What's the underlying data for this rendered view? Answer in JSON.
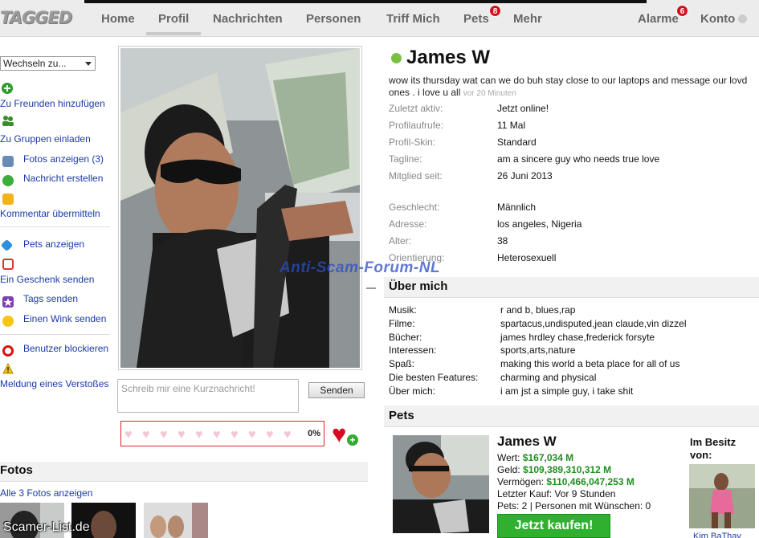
{
  "header": {
    "logo": "TAGGED",
    "nav": [
      {
        "label": "Home"
      },
      {
        "label": "Profil"
      },
      {
        "label": "Nachrichten"
      },
      {
        "label": "Personen"
      },
      {
        "label": "Triff Mich"
      },
      {
        "label": "Pets",
        "badge": "8"
      },
      {
        "label": "Mehr"
      }
    ],
    "alarme": {
      "label": "Alarme",
      "badge": "6"
    },
    "konto": "Konto"
  },
  "sidebar": {
    "switch_value": "Wechseln zu...",
    "actions": [
      {
        "label": "Zu Freunden hinzufügen",
        "icon": "add-friend-icon"
      },
      {
        "label": "Zu Gruppen einladen",
        "icon": "group-icon"
      },
      {
        "label": "Fotos anzeigen (3)",
        "icon": "camera-icon"
      },
      {
        "label": "Nachricht erstellen",
        "icon": "chat-bubble-icon"
      },
      {
        "label": "Kommentar übermitteln",
        "icon": "comment-icon"
      },
      {
        "label": "Pets anzeigen",
        "icon": "tag-icon"
      },
      {
        "label": "Ein Geschenk senden",
        "icon": "gift-icon"
      },
      {
        "label": "Tags senden",
        "icon": "star-icon"
      },
      {
        "label": "Einen Wink senden",
        "icon": "smiley-icon"
      },
      {
        "label": "Benutzer blockieren",
        "icon": "block-icon"
      },
      {
        "label": "Meldung eines Verstoßes",
        "icon": "warning-icon"
      }
    ]
  },
  "composer": {
    "placeholder": "Schreib mir eine Kurznachricht!",
    "send": "Senden",
    "meter_percent": "0%"
  },
  "fotos": {
    "title": "Fotos",
    "link": "Alle 3 Fotos anzeigen"
  },
  "watermarks": {
    "bottom": "Scamer-List.de",
    "center": "Anti-Scam-Forum-NL"
  },
  "profile": {
    "name": "James W",
    "status": "wow its thursday wat can we do buh stay close to our laptops and message our lovd ones . i love u all",
    "status_ago": "vor 20 Minuten",
    "details": [
      {
        "label": "Zuletzt aktiv:",
        "value": "Jetzt online!"
      },
      {
        "label": "Profilaufrufe:",
        "value": "11 Mal"
      },
      {
        "label": "Profil-Skin:",
        "value": "Standard"
      },
      {
        "label": "Tagline:",
        "value": "am a sincere guy who needs true love"
      },
      {
        "label": "Mitglied seit:",
        "value": "26 Juni 2013"
      }
    ],
    "details2": [
      {
        "label": "Geschlecht:",
        "value": "Männlich"
      },
      {
        "label": "Adresse:",
        "value": "los angeles, Nigeria"
      },
      {
        "label": "Alter:",
        "value": "38"
      },
      {
        "label": "Orientierung:",
        "value": "Heterosexuell"
      }
    ]
  },
  "about": {
    "title": "Über mich",
    "rows": [
      {
        "label": "Musik:",
        "value": "r and b, blues,rap"
      },
      {
        "label": "Filme:",
        "value": "spartacus,undisputed,jean claude,vin dizzel"
      },
      {
        "label": "Bücher:",
        "value": "james hrdley chase,frederick forsyte"
      },
      {
        "label": "Interessen:",
        "value": "sports,arts,nature"
      },
      {
        "label": "Spaß:",
        "value": "making this world a beta place for all of us"
      },
      {
        "label": "Die besten Features:",
        "value": "charming and physical"
      },
      {
        "label": "Über mich:",
        "value": "i am jst a simple guy, i take shit"
      }
    ]
  },
  "pets": {
    "title": "Pets",
    "name": "James W",
    "wert_label": "Wert:",
    "wert": "$167,034 M",
    "geld_label": "Geld:",
    "geld": "$109,389,310,312 M",
    "vermoegen_label": "Vermögen:",
    "vermoegen": "$110,466,047,253 M",
    "letzter_kauf": "Letzter Kauf: Vor 9 Stunden",
    "pets_line": "Pets: 2 | Personen mit Wünschen: 0",
    "buy": "Jetzt kaufen!",
    "owner_label": "Im Besitz von:",
    "owner_name": "Kim BaThav"
  }
}
